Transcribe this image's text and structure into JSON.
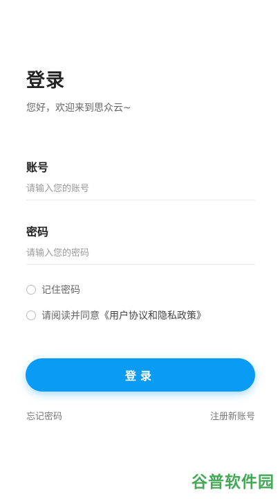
{
  "header": {
    "title": "登录",
    "subtitle": "您好，欢迎来到思众云~"
  },
  "form": {
    "account": {
      "label": "账号",
      "placeholder": "请输入您的账号",
      "value": ""
    },
    "password": {
      "label": "密码",
      "placeholder": "请输入您的密码",
      "value": ""
    },
    "remember": {
      "label": "记住密码",
      "checked": false
    },
    "agreement": {
      "prefix": "请阅读并同意",
      "link": "《用户协议和隐私政策》",
      "checked": false
    },
    "submit_label": "登录"
  },
  "footer": {
    "forgot_label": "忘记密码",
    "register_label": "注册新账号"
  },
  "watermark": {
    "text": "谷普软件园",
    "color": "#3ba54d"
  },
  "colors": {
    "accent": "#0a9bf4"
  }
}
